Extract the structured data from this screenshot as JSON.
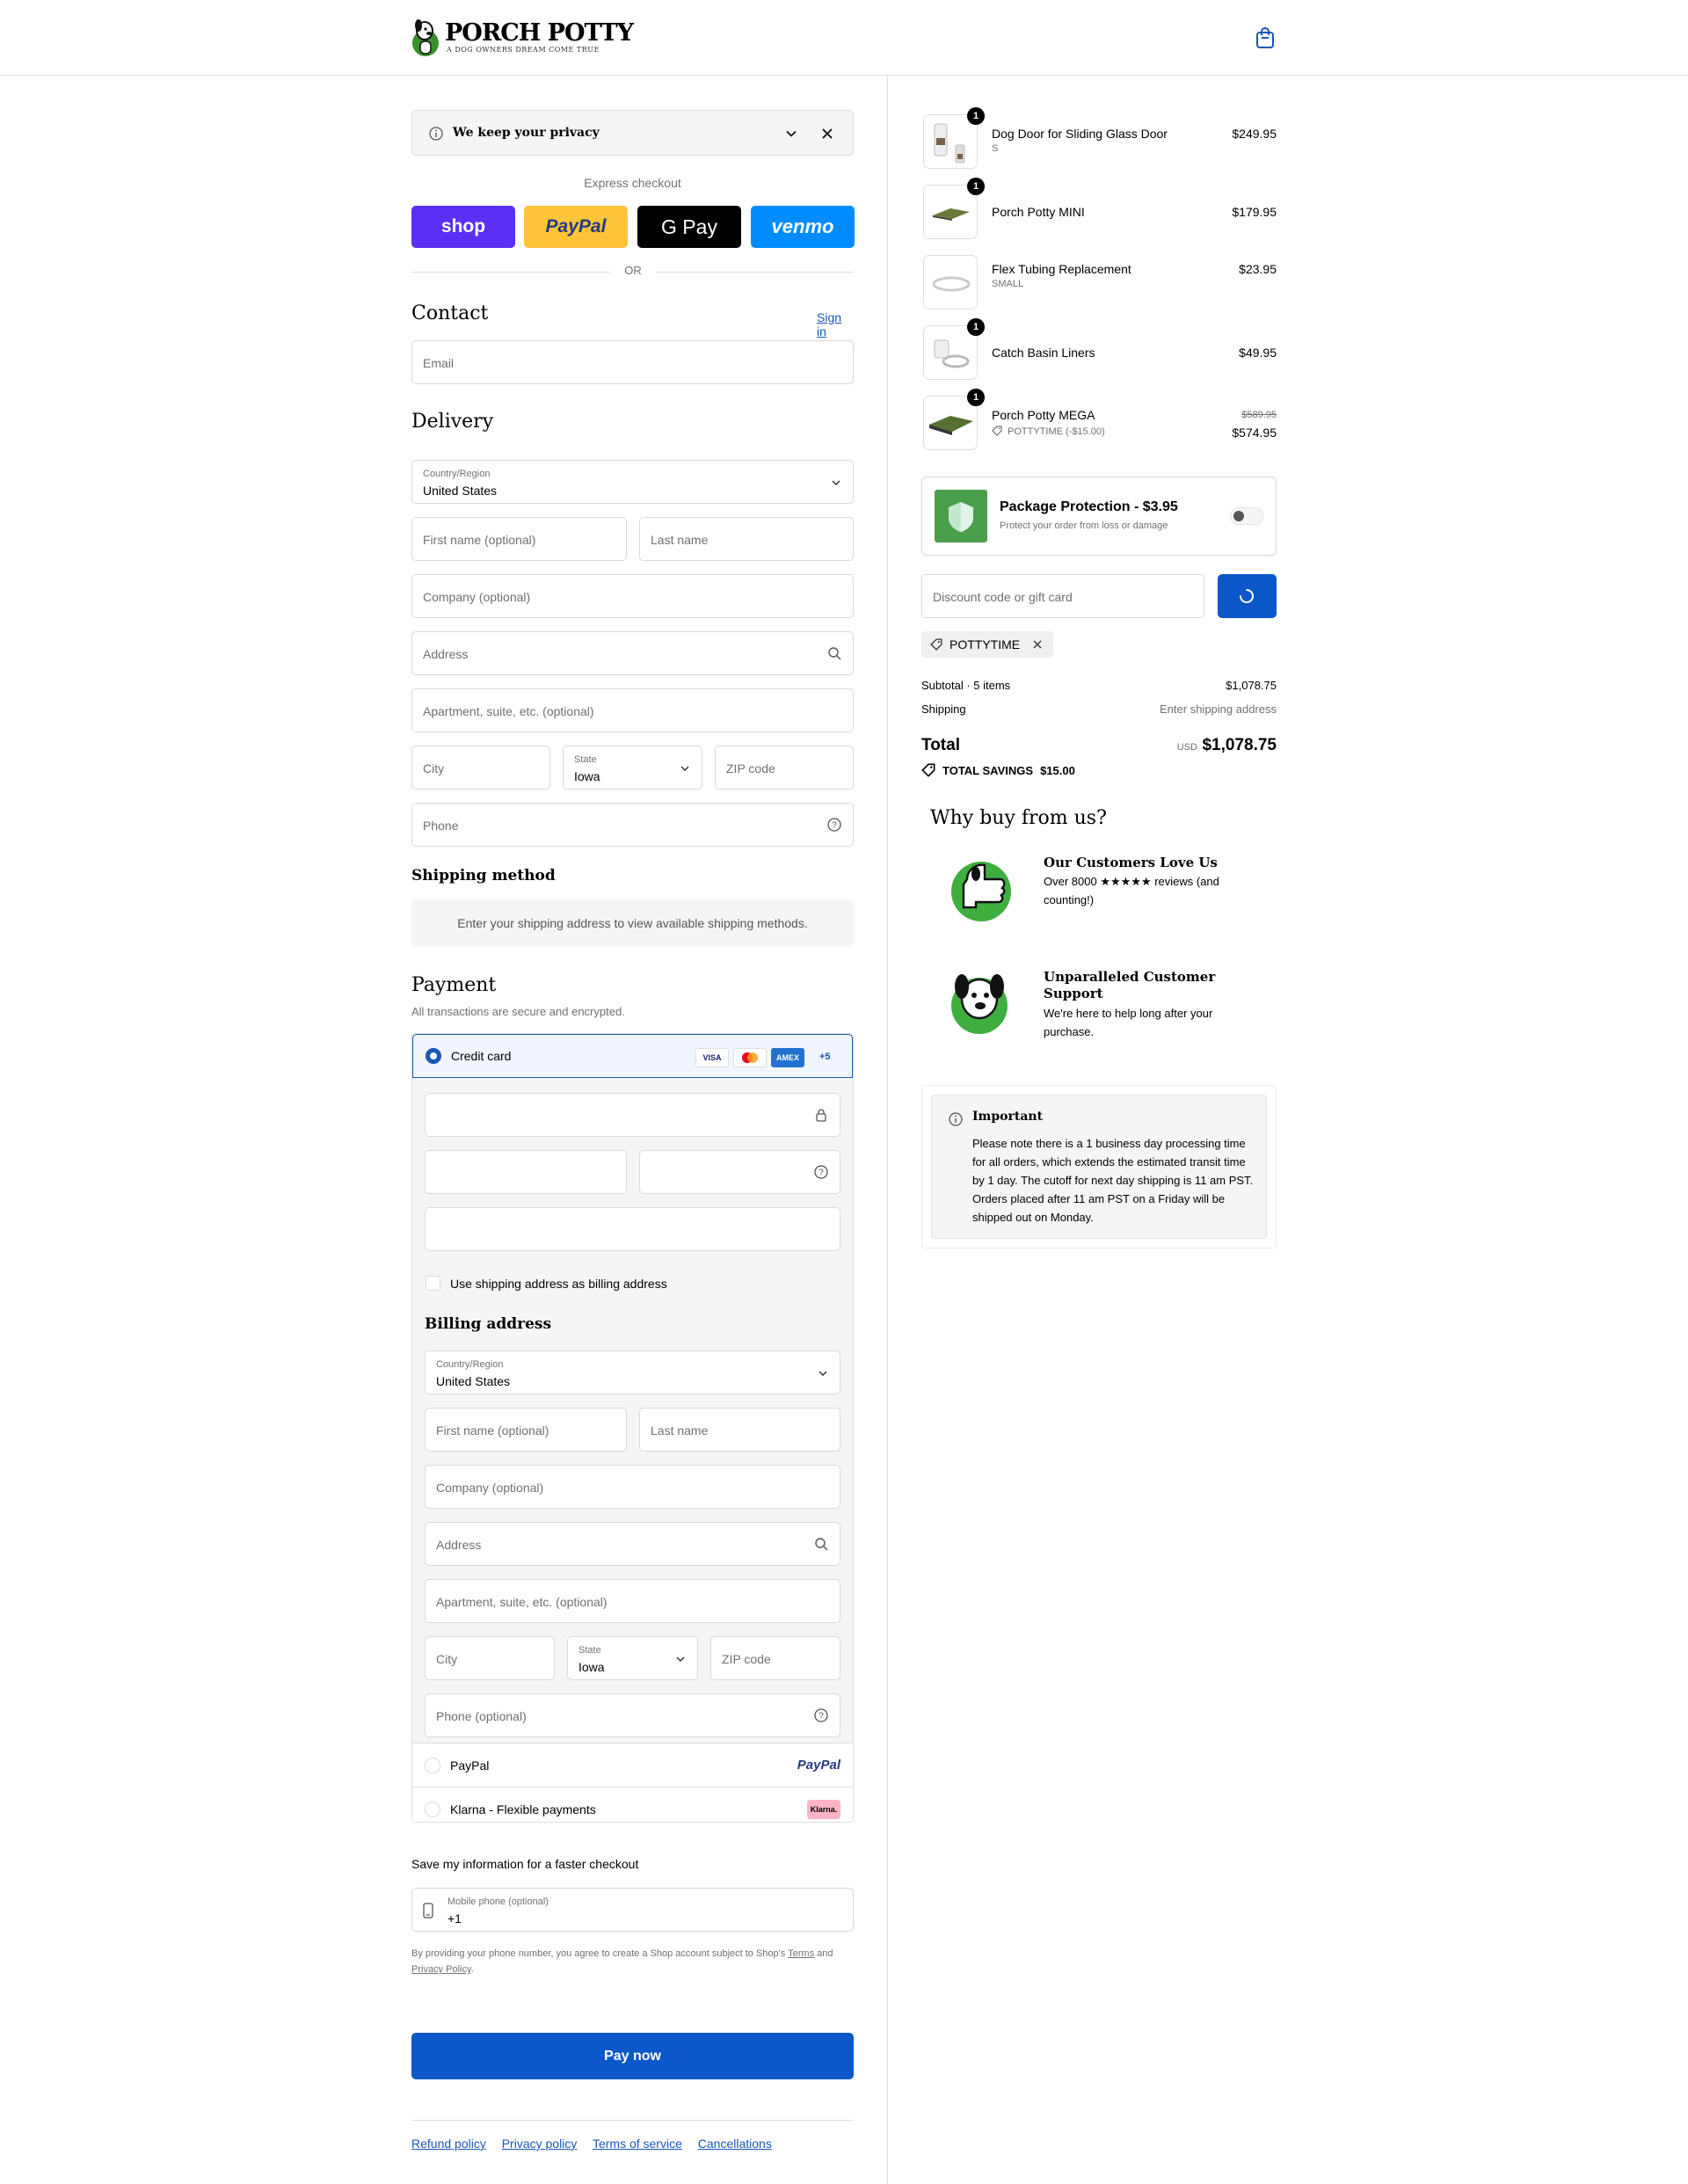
{
  "brand": {
    "name": "PORCH POTTY",
    "tagline": "A DOG OWNERS DREAM COME TRUE"
  },
  "privacy": {
    "title": "We keep your privacy"
  },
  "express": {
    "label": "Express checkout",
    "buttons": [
      "shop",
      "PayPal",
      "G Pay",
      "venmo"
    ],
    "or": "OR"
  },
  "contact": {
    "heading": "Contact",
    "sign_in": "Sign in",
    "email_placeholder": "Email"
  },
  "delivery": {
    "heading": "Delivery",
    "country_label": "Country/Region",
    "country_value": "United States",
    "first_name": "First name (optional)",
    "last_name": "Last name",
    "company": "Company (optional)",
    "address": "Address",
    "apartment": "Apartment, suite, etc. (optional)",
    "city": "City",
    "state_label": "State",
    "state_value": "Iowa",
    "zip": "ZIP code",
    "phone": "Phone"
  },
  "shipping_method": {
    "heading": "Shipping method",
    "notice": "Enter your shipping address to view available shipping methods."
  },
  "payment": {
    "heading": "Payment",
    "subtext": "All transactions are secure and encrypted.",
    "credit_card": "Credit card",
    "card_brands": [
      "VISA",
      "MC",
      "AMEX"
    ],
    "more_cards": "+5",
    "billing_checkbox": "Use shipping address as billing address",
    "billing_heading": "Billing address",
    "billing": {
      "country_label": "Country/Region",
      "country_value": "United States",
      "first_name": "First name (optional)",
      "last_name": "Last name",
      "company": "Company (optional)",
      "address": "Address",
      "apartment": "Apartment, suite, etc. (optional)",
      "city": "City",
      "state_label": "State",
      "state_value": "Iowa",
      "zip": "ZIP code",
      "phone": "Phone (optional)"
    },
    "paypal": "PayPal",
    "paypal_logo": "PayPal",
    "klarna": "Klarna - Flexible payments",
    "klarna_logo": "Klarna."
  },
  "save_info": {
    "heading": "Save my information for a faster checkout",
    "phone_label": "Mobile phone (optional)",
    "phone_value": "+1",
    "legal_prefix": "By providing your phone number, you agree to create a Shop account subject to Shop's",
    "terms": "Terms",
    "and": "and",
    "privacy_policy": "Privacy Policy",
    "dot": "."
  },
  "pay_now": "Pay now",
  "footer_links": [
    "Refund policy",
    "Privacy policy",
    "Terms of service",
    "Cancellations"
  ],
  "cart": {
    "items": [
      {
        "qty": "1",
        "name": "Dog Door for Sliding Glass Door",
        "variant": "S",
        "price": "$249.95"
      },
      {
        "qty": "1",
        "name": "Porch Potty MINI",
        "variant": "",
        "price": "$179.95"
      },
      {
        "qty": "1",
        "name": "Flex Tubing Replacement",
        "variant": "SMALL",
        "price": "$23.95"
      },
      {
        "qty": "1",
        "name": "Catch Basin Liners",
        "variant": "",
        "price": "$49.95"
      },
      {
        "qty": "1",
        "name": "Porch Potty MEGA",
        "variant": "POTTYTIME (-$15.00)",
        "original_price": "$589.95",
        "price": "$574.95"
      }
    ],
    "protection": {
      "title": "Package Protection - $3.95",
      "subtitle": "Protect your order from loss or damage"
    },
    "discount_placeholder": "Discount code or gift card",
    "applied_code": "POTTYTIME",
    "subtotal_label": "Subtotal · 5 items",
    "subtotal_value": "$1,078.75",
    "shipping_label": "Shipping",
    "shipping_value": "Enter shipping address",
    "total_label": "Total",
    "currency": "USD",
    "total_value": "$1,078.75",
    "savings_label": "TOTAL SAVINGS",
    "savings_value": "$15.00"
  },
  "why": {
    "heading": "Why buy from us?",
    "blocks": [
      {
        "title": "Our Customers Love Us",
        "text": "Over 8000 ★★★★★ reviews (and counting!)"
      },
      {
        "title": "Unparalleled Customer Support",
        "text": "We're here to help long after your purchase."
      }
    ]
  },
  "important": {
    "title": "Important",
    "text": "Please note there is a 1 business day processing time for all orders, which extends the estimated transit time by 1 day. The cutoff for next day shipping is 11 am PST. Orders placed after 11 am PST on a Friday will be shipped out on Monday."
  },
  "colors": {
    "accent": "#1857b8",
    "brand_green": "#3a8f2c",
    "paypal_yellow": "#ffc43a",
    "shop_purple": "#5a31f4",
    "venmo_blue": "#008cff"
  }
}
